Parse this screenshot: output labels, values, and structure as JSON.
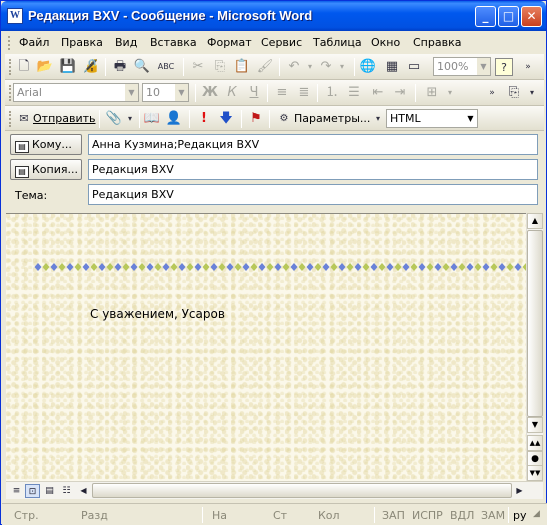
{
  "window": {
    "app_icon": "W",
    "title": "Редакция BXV - Сообщение - Microsoft Word",
    "minimize": "_",
    "maximize": "□",
    "close": "✕"
  },
  "menu": [
    "Файл",
    "Правка",
    "Вид",
    "Вставка",
    "Формат",
    "Сервис",
    "Таблица",
    "Окно",
    "Справка"
  ],
  "standard_toolbar": {
    "zoom": "100%"
  },
  "format_toolbar": {
    "font": "Arial",
    "size": "10",
    "bold": "Ж",
    "italic": "К",
    "underline": "Ч"
  },
  "email_toolbar": {
    "send_label": "Отправить",
    "options_label": "Параметры...",
    "format": "HTML"
  },
  "address": {
    "to_label": "Кому...",
    "to_value": "Анна Кузмина;Редакция BXV",
    "cc_label": "Копия...",
    "cc_value": "Редакция BXV",
    "subject_label": "Тема:",
    "subject_value": "Редакция BXV"
  },
  "document": {
    "signature": "С уважением, Усаров"
  },
  "statusbar": {
    "page": "Стр.",
    "section": "Разд",
    "at": "На",
    "line": "Ст",
    "col": "Кол",
    "rec": "ЗАП",
    "trk": "ИСПР",
    "ext": "ВДЛ",
    "ovr": "ЗАМ",
    "lang": "ру"
  },
  "colors": {
    "titlebar": "#0058ee",
    "doc_background": "#fbf8ea",
    "diamond_blue": "#6a82d8",
    "diamond_green": "#b8c85a"
  }
}
